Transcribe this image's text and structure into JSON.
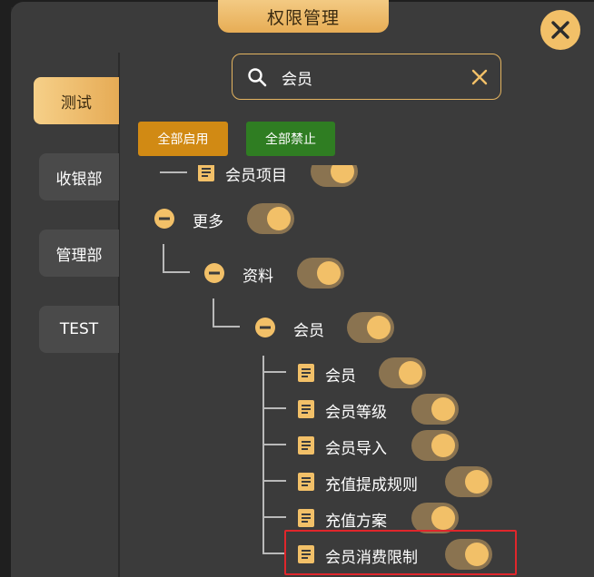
{
  "dialog": {
    "title": "权限管理",
    "close_icon": "close-icon"
  },
  "sidebar": {
    "tabs": [
      {
        "label": "测试",
        "active": true
      },
      {
        "label": "收银部",
        "active": false
      },
      {
        "label": "管理部",
        "active": false
      },
      {
        "label": "TEST",
        "active": false
      }
    ]
  },
  "search": {
    "value": "会员",
    "icon": "search-icon",
    "clear_icon": "clear-icon"
  },
  "actions": {
    "enable_all": "全部启用",
    "disable_all": "全部禁止"
  },
  "tree": {
    "partial_top": {
      "label": "会员项目",
      "enabled": true
    },
    "more": {
      "label": "更多",
      "enabled": true
    },
    "profile": {
      "label": "资料",
      "enabled": true
    },
    "member": {
      "label": "会员",
      "enabled": true
    },
    "leaves": [
      {
        "label": "会员",
        "enabled": true
      },
      {
        "label": "会员等级",
        "enabled": true
      },
      {
        "label": "会员导入",
        "enabled": true
      },
      {
        "label": "充值提成规则",
        "enabled": true
      },
      {
        "label": "充值方案",
        "enabled": true
      },
      {
        "label": "会员消费限制",
        "enabled": true,
        "highlighted": true
      }
    ]
  },
  "colors": {
    "accent": "#f2c068",
    "toggle_track": "#8a7350",
    "enable_button": "#d18a14",
    "disable_button": "#2f7d22",
    "highlight_border": "#e0262b"
  }
}
